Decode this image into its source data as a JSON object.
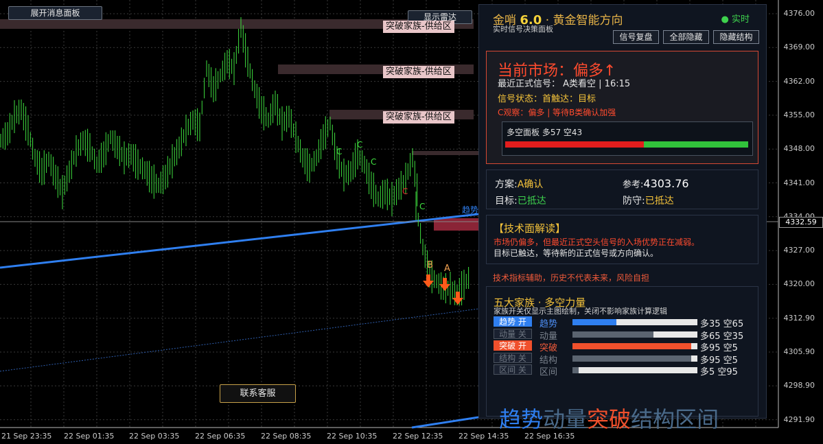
{
  "top_buttons": {
    "expand_panel": "展开消息面板",
    "show_radar": "显示雷达",
    "contact": "联系客服"
  },
  "zones": [
    "突破家族-供给区",
    "突破家族-供给区",
    "突破家族-供给区"
  ],
  "price_axis": [
    "4376.00",
    "4369.00",
    "4362.00",
    "4355.00",
    "4348.00",
    "4341.00",
    "4334.00",
    "4327.00",
    "4320.00",
    "4312.90",
    "4305.90",
    "4298.90",
    "4291.90"
  ],
  "current_price": "4332.59",
  "time_axis": [
    "21 Sep 23:35",
    "22 Sep 01:35",
    "22 Sep 03:35",
    "22 Sep 06:35",
    "22 Sep 08:35",
    "22 Sep 10:35",
    "22 Sep 12:35",
    "22 Sep 14:35",
    "22 Sep 16:35"
  ],
  "chart_marks": {
    "c1": "C",
    "c2": "C",
    "c3": "C",
    "c4": "C",
    "b": "B",
    "a": "A",
    "trend": "趋势"
  },
  "panel": {
    "title_prefix": "金哨",
    "title_version": "6.0",
    "title_suffix": " · 黄金智能方向",
    "subtitle": "实时信号决策面板",
    "live": "● 实时",
    "buttons": [
      "信号复盘",
      "全部隐藏",
      "隐藏结构"
    ],
    "market": {
      "headline": "当前市场：偏多↑",
      "last_signal": "最近正式信号： A类看空 | 16:15",
      "status": "信号状态：首触达：目标",
      "observe": "C观察：偏多 | 等待B类确认加强",
      "ls_label": "多空面板  多57 空43",
      "long_pct": 57
    },
    "plan": {
      "plan_label": "方案:",
      "plan_value": "A确认",
      "ref_label": "参考:",
      "ref_value": "4303.76",
      "target_label": "目标:",
      "target_value": "已抵达",
      "defend_label": "防守:",
      "defend_value": "已抵达"
    },
    "tech": {
      "title": "【技术面解读】",
      "line1": "市场仍偏多，但最近正式空头信号的入场优势正在减弱。",
      "line2": "目标已触达，等待新的正式信号或方向确认。"
    },
    "disclaimer": "技术指标辅助，历史不代表未来，风险自担",
    "family": {
      "title": "五大家族 · 多空力量",
      "note": "家族开关仅显示主图绘制，关闭不影响家族计算逻辑",
      "rows": [
        {
          "toggle": "趋势 开",
          "on": true,
          "name": "趋势",
          "long": 35,
          "text": "多35 空65",
          "color": "#2f7ff0"
        },
        {
          "toggle": "动量 关",
          "on": false,
          "name": "动量",
          "long": 65,
          "text": "多65 空35",
          "color": "#5b6470"
        },
        {
          "toggle": "突破 开",
          "on": true,
          "name": "突破",
          "long": 95,
          "text": "多95 空5",
          "color": "#f0502c"
        },
        {
          "toggle": "结构 关",
          "on": false,
          "name": "结构",
          "long": 95,
          "text": "多95 空5",
          "color": "#5b6470"
        },
        {
          "toggle": "区间 关",
          "on": false,
          "name": "区间",
          "long": 5,
          "text": "多5 空95",
          "color": "#5b6470"
        }
      ],
      "legend": [
        "趋势",
        "动量",
        "突破",
        "结构",
        "区间"
      ]
    }
  }
}
